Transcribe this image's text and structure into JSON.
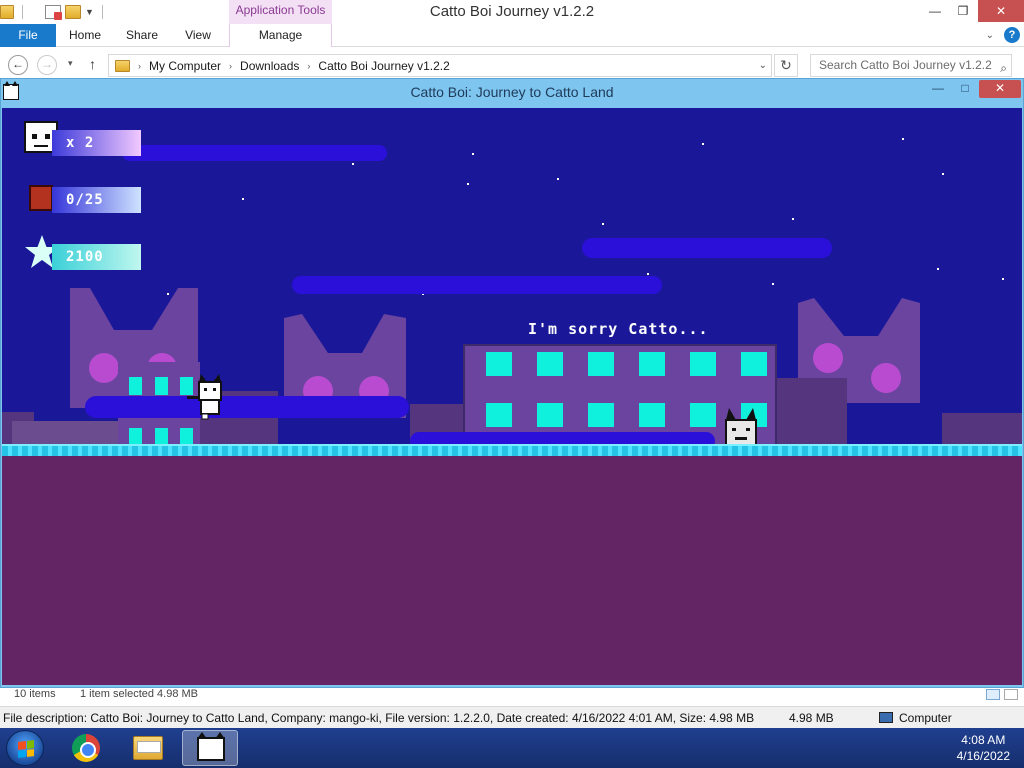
{
  "explorer": {
    "window_title": "Catto Boi Journey v1.2.2",
    "context_tab_group": "Application Tools",
    "controls": {
      "minimize": "—",
      "restore": "❐",
      "close": "✕"
    },
    "ribbon": {
      "tabs": [
        "File",
        "Home",
        "Share",
        "View",
        "Manage"
      ],
      "help": "?",
      "collapse": "⌄"
    },
    "nav": {
      "back": "←",
      "forward": "→",
      "recent": "▾",
      "up": "↑"
    },
    "address": {
      "crumbs": [
        "My Computer",
        "Downloads",
        "Catto Boi Journey v1.2.2"
      ],
      "separator": "›",
      "dropdown": "⌄",
      "refresh": "↻"
    },
    "search": {
      "placeholder": "Search Catto Boi Journey v1.2.2",
      "icon": "⌕"
    },
    "status": {
      "items_count": "10 items",
      "selection": "1 item selected  4.98 MB"
    },
    "details": {
      "description": "File description: Catto Boi: Journey to Catto Land, Company: mango-ki, File version: 1.2.2.0, Date created: 4/16/2022 4:01 AM, Size: 4.98 MB",
      "size": "4.98 MB",
      "location": "Computer"
    }
  },
  "game_window": {
    "title": "Catto Boi: Journey to Catto Land",
    "controls": {
      "minimize": "—",
      "maximize": "□",
      "close": "✕"
    }
  },
  "game": {
    "hud": {
      "lives": "x 2",
      "crates": "0/25",
      "score": "2100"
    },
    "dialog": "I'm sorry Catto...",
    "colors": {
      "sky": "#1a1899",
      "ground": "#642564",
      "grass": "#25c3e6",
      "building": "#6a449f",
      "window": "#10f1dd",
      "cloud": "#2a10d8"
    }
  },
  "taskbar": {
    "time": "4:08 AM",
    "date": "4/16/2022"
  }
}
